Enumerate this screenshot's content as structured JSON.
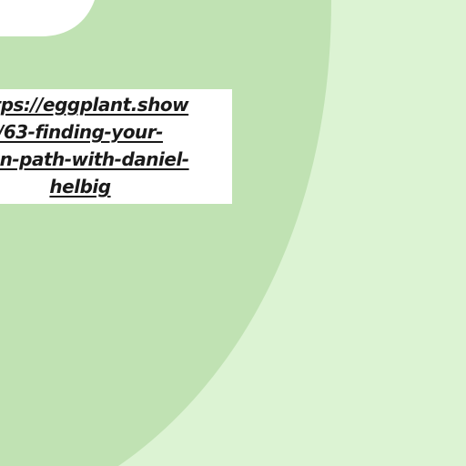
{
  "link": {
    "lines": [
      "https://eggplant.show",
      "/63-finding-your-",
      "own-path-with-daniel-",
      "helbig"
    ]
  },
  "colors": {
    "background": "#dcf3d3",
    "arc": "#c0e2b3",
    "panel": "#ffffff",
    "text": "#1a1a1a"
  }
}
